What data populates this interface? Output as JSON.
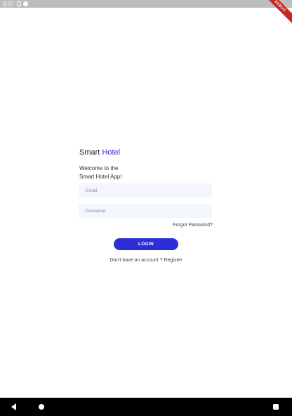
{
  "status_bar": {
    "time": "6:07"
  },
  "debug_banner": {
    "label": "DEBUG"
  },
  "brand": {
    "part1": "Smart",
    "part2": "Hotel",
    "accent_color": "#2b2bd6"
  },
  "welcome": {
    "line1": "Welcome to the",
    "line2": "Smart Hotel App!"
  },
  "form": {
    "email_placeholder": "Email",
    "password_placeholder": "Password",
    "forgot_label": "Forgot Password?",
    "login_label": "LOGIN",
    "login_color": "#2e2ed9"
  },
  "register": {
    "prompt": "Don't have an account ?",
    "link": "Register"
  },
  "nav_bar": {
    "icons": [
      "back-icon",
      "home-icon",
      "recents-icon"
    ]
  }
}
